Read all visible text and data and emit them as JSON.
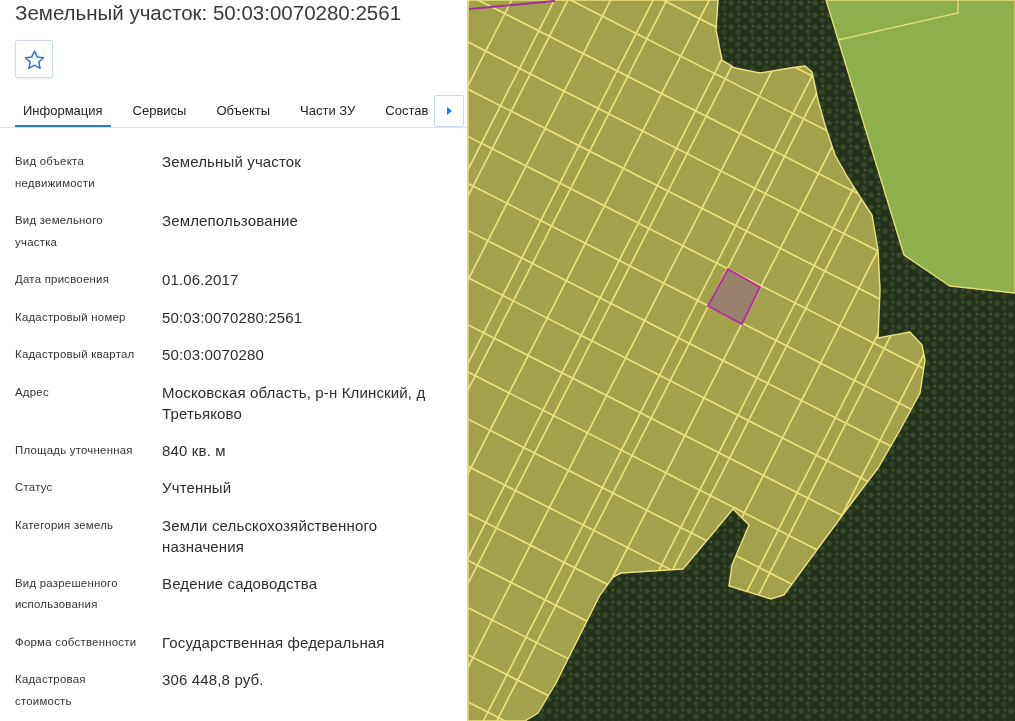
{
  "title": "Земельный участок: 50:03:0070280:2561",
  "favorite_button": {
    "starred": false
  },
  "tabs": [
    {
      "label": "Информация",
      "selected": true
    },
    {
      "label": "Сервисы",
      "selected": false
    },
    {
      "label": "Объекты",
      "selected": false
    },
    {
      "label": "Части ЗУ",
      "selected": false
    },
    {
      "label": "Состав",
      "selected": false
    }
  ],
  "fields": [
    {
      "label": "Вид объекта недвижимости",
      "value": "Земельный участок"
    },
    {
      "label": "Вид земельного участка",
      "value": "Землепользование"
    },
    {
      "label": "Дата присвоения",
      "value": "01.06.2017"
    },
    {
      "label": "Кадастровый номер",
      "value": "50:03:0070280:2561"
    },
    {
      "label": "Кадастровый квартал",
      "value": "50:03:0070280"
    },
    {
      "label": "Адрес",
      "value": "Московская область, р-н Клинский, д Третьяково"
    },
    {
      "label": "Площадь уточненная",
      "value": "840 кв. м"
    },
    {
      "label": "Статус",
      "value": "Учтенный"
    },
    {
      "label": "Категория земель",
      "value": "Земли сельскохозяйственного назначения"
    },
    {
      "label": "Вид разрешенного использования",
      "value": "Ведение садоводства"
    },
    {
      "label": "Форма собственности",
      "value": "Государственная федеральная"
    },
    {
      "label": "Кадастровая стоимость",
      "value": "306 448,8 руб."
    }
  ]
}
